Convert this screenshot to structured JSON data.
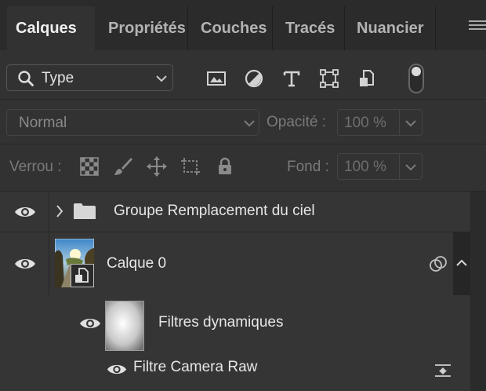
{
  "tabs": [
    {
      "label": "Calques",
      "active": true
    },
    {
      "label": "Propriétés",
      "active": false
    },
    {
      "label": "Couches",
      "active": false
    },
    {
      "label": "Tracés",
      "active": false
    },
    {
      "label": "Nuancier",
      "active": false
    }
  ],
  "filter": {
    "kind_label": "Type",
    "icons": [
      "image-filter-icon",
      "adjustment-filter-icon",
      "text-filter-icon",
      "shape-filter-icon",
      "smart-object-filter-icon"
    ],
    "toggle_on": true
  },
  "blend": {
    "mode": "Normal",
    "opacity_label": "Opacité :",
    "opacity_value": "100 %"
  },
  "lock": {
    "label": "Verrou :",
    "icons": [
      "lock-transparent-pixels-icon",
      "lock-image-pixels-icon",
      "lock-position-icon",
      "lock-artboard-icon",
      "lock-all-icon"
    ],
    "fill_label": "Fond :",
    "fill_value": "100 %"
  },
  "layers": [
    {
      "name": "Groupe Remplacement du ciel",
      "type": "group",
      "visible": true
    },
    {
      "name": "Calque 0",
      "type": "smart-object",
      "visible": true
    },
    {
      "name": "Filtres dynamiques",
      "type": "smart-filter-mask",
      "visible": true
    },
    {
      "name": "Filtre Camera Raw",
      "type": "filter",
      "visible": true
    }
  ],
  "colors": {
    "panel_bg": "#323232",
    "tabbar_bg": "#2b2b2b",
    "text_primary": "#e6e6e6",
    "text_disabled": "#7a7a7a"
  }
}
